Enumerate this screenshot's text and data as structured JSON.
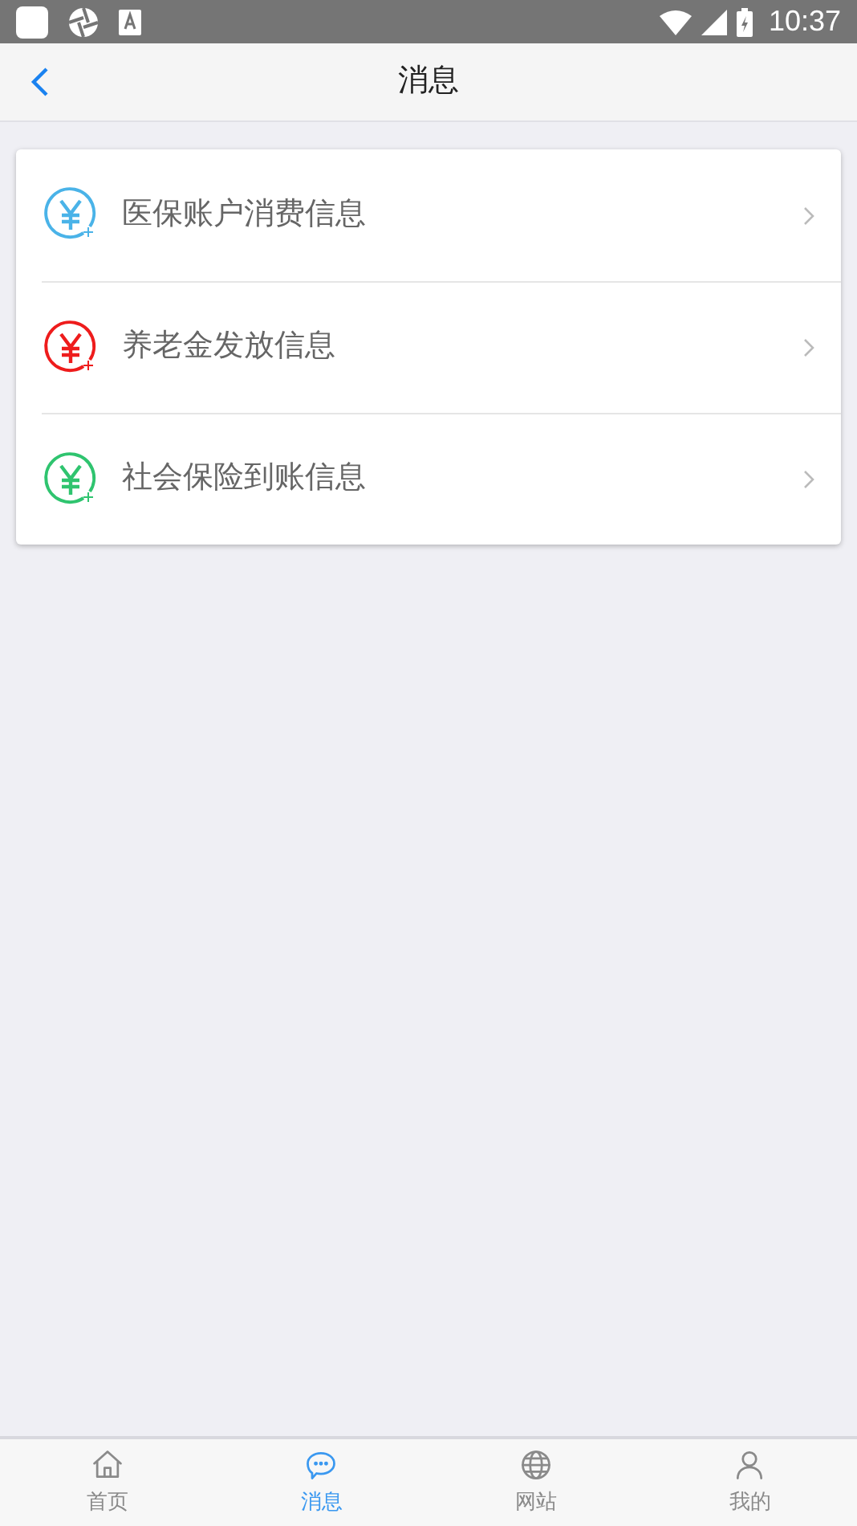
{
  "status_bar": {
    "time": "10:37"
  },
  "header": {
    "title": "消息"
  },
  "messages": [
    {
      "label": "医保账户消费信息",
      "color": "#4ab3e8"
    },
    {
      "label": "养老金发放信息",
      "color": "#ee1c1c"
    },
    {
      "label": "社会保险到账信息",
      "color": "#2fc46f"
    }
  ],
  "tab_bar": [
    {
      "label": "首页",
      "kind": "home",
      "selected": false
    },
    {
      "label": "消息",
      "kind": "chat",
      "selected": true
    },
    {
      "label": "网站",
      "kind": "globe",
      "selected": false
    },
    {
      "label": "我的",
      "kind": "user",
      "selected": false
    }
  ]
}
